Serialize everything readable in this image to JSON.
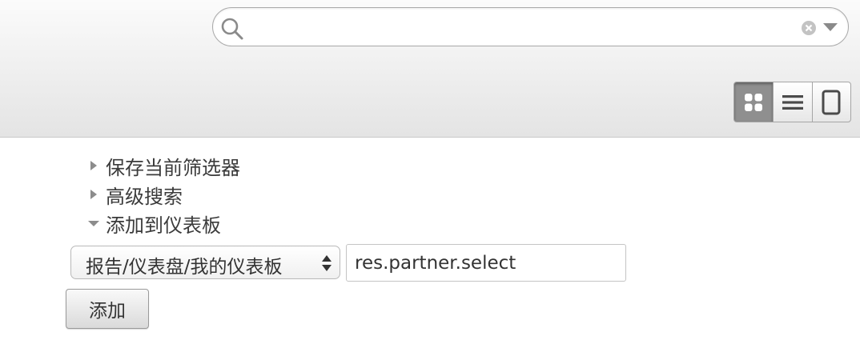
{
  "search": {
    "value": "",
    "placeholder": ""
  },
  "view_switcher": {
    "active": "kanban",
    "items": [
      "kanban-icon",
      "list-icon",
      "form-icon"
    ]
  },
  "filters": {
    "save_current": "保存当前筛选器",
    "advanced_search": "高级搜索",
    "add_to_dashboard": "添加到仪表板",
    "dashboard_select": {
      "selected": "报告/仪表盘/我的仪表板"
    },
    "filter_name_value": "res.partner.select",
    "add_button": "添加"
  },
  "colors": {
    "topbar_start": "#fbfbfb",
    "topbar_end": "#e4e4e4",
    "active_view": "#8f8f8f",
    "text": "#3b3b3b"
  }
}
